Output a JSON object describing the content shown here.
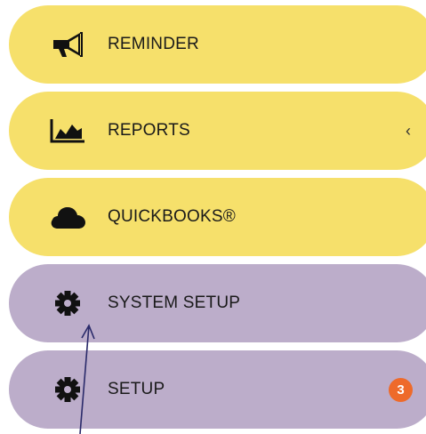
{
  "menu": {
    "items": [
      {
        "label": "REMINDER",
        "icon": "megaphone-icon"
      },
      {
        "label": "REPORTS",
        "icon": "area-chart-icon",
        "chevron": "‹"
      },
      {
        "label": "QUICKBOOKS®",
        "icon": "cloud-icon"
      },
      {
        "label": "SYSTEM SETUP",
        "icon": "gear-icon"
      },
      {
        "label": "SETUP",
        "icon": "gear-icon",
        "badge": "3"
      }
    ]
  },
  "colors": {
    "yellow": "#f6e06b",
    "purple": "#bcadca",
    "badge": "#ee6a2a"
  }
}
